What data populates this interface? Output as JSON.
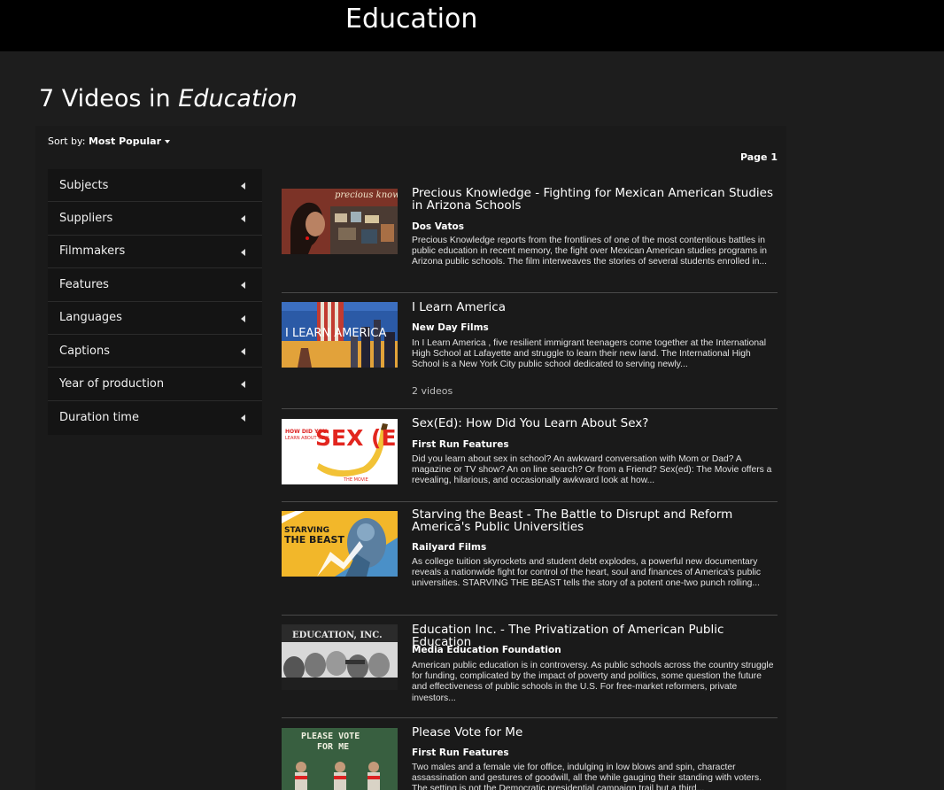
{
  "header": {
    "title": "Education"
  },
  "page": {
    "count_text": "7 Videos in ",
    "category": "Education"
  },
  "sort": {
    "label": "Sort by:",
    "value": "Most Popular"
  },
  "pagination": {
    "label": "Page 1"
  },
  "filters": [
    "Subjects",
    "Suppliers",
    "Filmmakers",
    "Features",
    "Languages",
    "Captions",
    "Year of production",
    "Duration time"
  ],
  "videos": [
    {
      "title": "Precious Knowledge - Fighting for Mexican American Studies in Arizona Schools",
      "supplier": "Dos Vatos",
      "description": "Precious Knowledge reports from the frontlines of one of the most contentious battles in public education in recent memory, the fight over Mexican American studies programs in Arizona public schools. The film interweaves the stories of several students enrolled in...",
      "thumb_text": "precious knowledge"
    },
    {
      "title": "I Learn America",
      "supplier": "New Day Films",
      "description": "In I Learn America , five resilient immigrant teenagers come together at the International High School at Lafayette and struggle to learn their new land. The International High School is a New York City public school dedicated to serving newly...",
      "count": "2 videos",
      "thumb_text": "I LEARN AMERICA"
    },
    {
      "title": "Sex(Ed): How Did You Learn About Sex?",
      "supplier": "First Run Features",
      "description": "Did you learn about sex in school? An awkward conversation with Mom or Dad? A magazine or TV show? An on line search? Or from a Friend? Sex(ed): The Movie offers a revealing, hilarious, and occasionally awkward look at how...",
      "thumb_text": "SEX (ED)"
    },
    {
      "title": "Starving the Beast - The Battle to Disrupt and Reform America's Public Universities",
      "supplier": "Railyard Films",
      "description": "As college tuition skyrockets and student debt explodes, a powerful new documentary reveals a nationwide fight for control of the heart, soul and finances of America's public universities. STARVING THE BEAST tells the story of a potent one-two punch rolling...",
      "thumb_text": "STARVING THE BEAST"
    },
    {
      "title": "Education Inc. - The Privatization of American Public Education",
      "supplier": "Media Education Foundation",
      "description": "American public education is in controversy. As public schools across the country struggle for funding, complicated by the impact of poverty and politics, some question the future and effectiveness of public schools in the U.S. For free-market reformers, private investors...",
      "thumb_text": "EDUCATION, INC."
    },
    {
      "title": "Please Vote for Me",
      "supplier": "First Run Features",
      "description": "Two males and a female vie for office, indulging in low blows and spin, character assassination and gestures of goodwill, all the while gauging their standing with voters. The setting is not the Democratic presidential campaign trail but a third...",
      "thumb_text": "PLEASE VOTE FOR ME"
    }
  ]
}
